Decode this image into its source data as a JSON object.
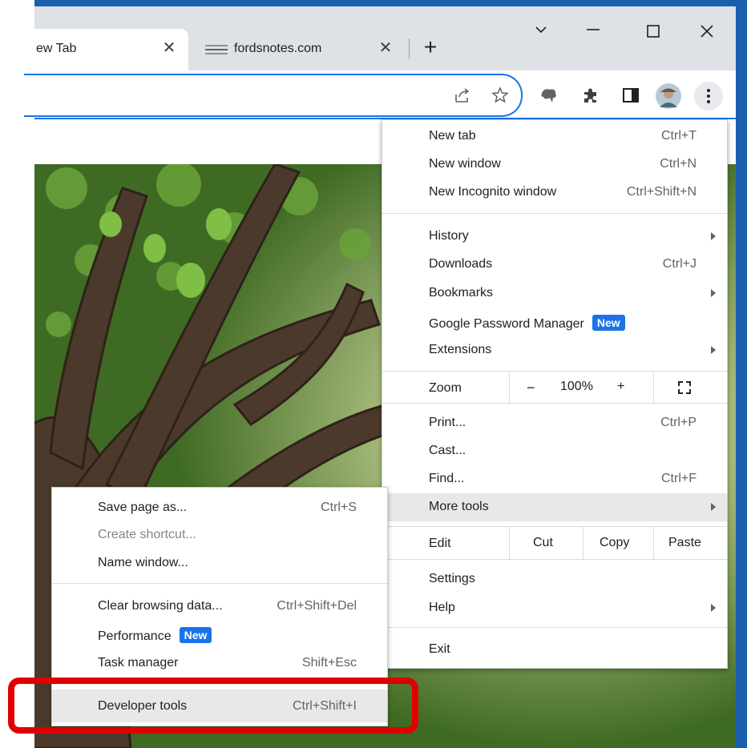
{
  "tabs": [
    {
      "label": "ew Tab",
      "close_glyph": "✕",
      "active": true
    },
    {
      "label": "fordsnotes.com",
      "close_glyph": "✕",
      "active": false
    }
  ],
  "new_tab_glyph": "+",
  "window_controls": {
    "list_tabs": "⌵",
    "minimize": "—",
    "maximize": "☐",
    "close": "✕"
  },
  "toolbar_icons": [
    "share-icon",
    "bookmark-star-icon",
    "extension-blob-icon",
    "puzzle-icon",
    "side-panel-icon",
    "profile-avatar",
    "kebab-menu-icon"
  ],
  "menu": {
    "group1": [
      {
        "label": "New tab",
        "shortcut": "Ctrl+T"
      },
      {
        "label": "New window",
        "shortcut": "Ctrl+N"
      },
      {
        "label": "New Incognito window",
        "shortcut": "Ctrl+Shift+N"
      }
    ],
    "group2": [
      {
        "label": "History",
        "submenu": true
      },
      {
        "label": "Downloads",
        "shortcut": "Ctrl+J"
      },
      {
        "label": "Bookmarks",
        "submenu": true
      },
      {
        "label": "Google Password Manager",
        "badge": "New"
      },
      {
        "label": "Extensions",
        "submenu": true
      }
    ],
    "zoom": {
      "label": "Zoom",
      "minus": "−",
      "value": "100%",
      "plus": "+",
      "fullscreen_icon": "fullscreen-icon"
    },
    "group3": [
      {
        "label": "Print...",
        "shortcut": "Ctrl+P"
      },
      {
        "label": "Cast..."
      },
      {
        "label": "Find...",
        "shortcut": "Ctrl+F"
      },
      {
        "label": "More tools",
        "submenu": true,
        "highlighted": true
      }
    ],
    "edit": {
      "label": "Edit",
      "cut": "Cut",
      "copy": "Copy",
      "paste": "Paste"
    },
    "group4": [
      {
        "label": "Settings"
      },
      {
        "label": "Help",
        "submenu": true
      }
    ],
    "exit": {
      "label": "Exit"
    }
  },
  "submenu": {
    "items": [
      {
        "label": "Save page as...",
        "shortcut": "Ctrl+S"
      },
      {
        "label": "Create shortcut...",
        "disabled": true
      },
      {
        "label": "Name window..."
      },
      {
        "label": "Clear browsing data...",
        "shortcut": "Ctrl+Shift+Del"
      },
      {
        "label": "Performance",
        "badge": "New"
      },
      {
        "label": "Task manager",
        "shortcut": "Shift+Esc"
      },
      {
        "label": "Developer tools",
        "shortcut": "Ctrl+Shift+I",
        "highlighted": true
      }
    ]
  },
  "colors": {
    "accent": "#1a73e8",
    "callout": "#e00000",
    "frame": "#1a5fae"
  }
}
